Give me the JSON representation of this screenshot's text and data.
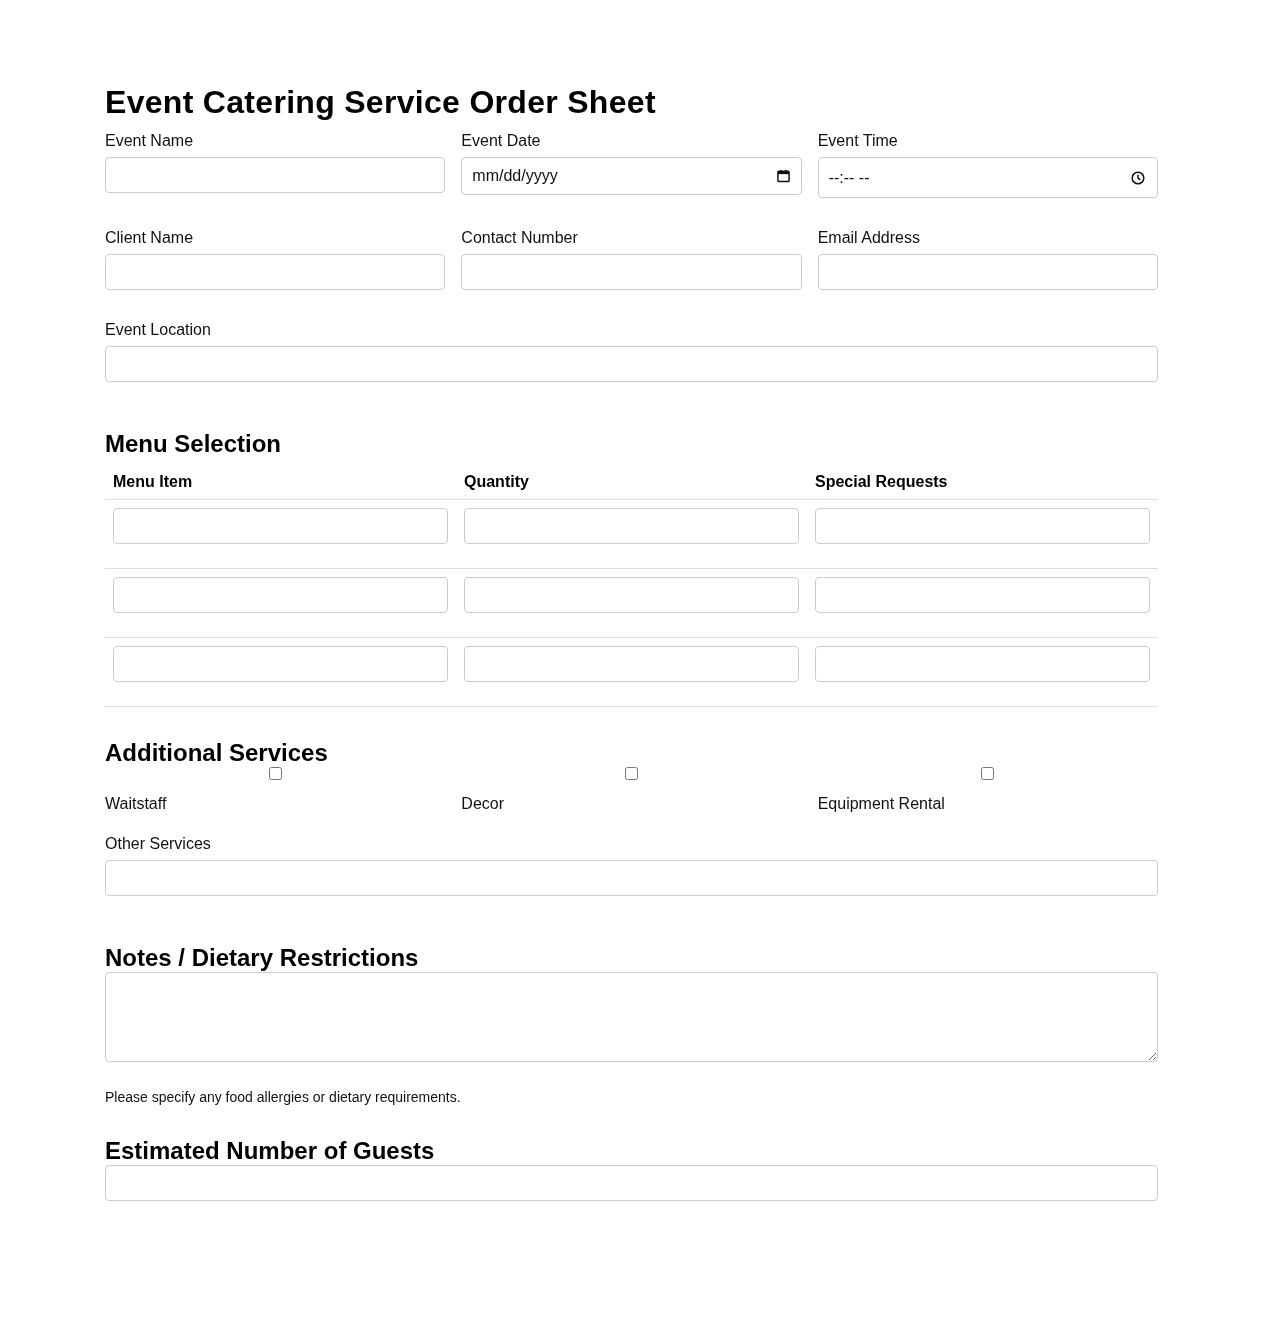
{
  "title": "Event Catering Service Order Sheet",
  "field_rows": [
    {
      "fields": [
        {
          "label": "Event Name",
          "kind": "text"
        },
        {
          "label": "Event Date",
          "kind": "date",
          "placeholder": "mm/dd/yyyy"
        },
        {
          "label": "Event Time",
          "kind": "time",
          "placeholder": "--:-- --"
        }
      ]
    },
    {
      "fields": [
        {
          "label": "Client Name",
          "kind": "text"
        },
        {
          "label": "Contact Number",
          "kind": "text"
        },
        {
          "label": "Email Address",
          "kind": "text"
        }
      ]
    },
    {
      "fields": [
        {
          "label": "Event Location",
          "kind": "text"
        }
      ]
    }
  ],
  "menu_selection": {
    "title": "Menu Selection",
    "columns": [
      "Menu Item",
      "Quantity",
      "Special Requests"
    ],
    "rows": [
      {
        "kind": "inputs"
      },
      {
        "kind": "inputs"
      },
      {
        "kind": "inputs"
      }
    ]
  },
  "additional_services": {
    "title": "Additional Services",
    "options": [
      {
        "label": "Waitstaff",
        "checked": false
      },
      {
        "label": "Decor",
        "checked": false
      },
      {
        "label": "Equipment Rental",
        "checked": false
      }
    ],
    "other": {
      "label": "Other Services"
    }
  },
  "notes": {
    "title": "Notes / Dietary Restrictions",
    "hint": "Please specify any food allergies or dietary requirements."
  },
  "guests": {
    "title": "Estimated Number of Guests"
  }
}
